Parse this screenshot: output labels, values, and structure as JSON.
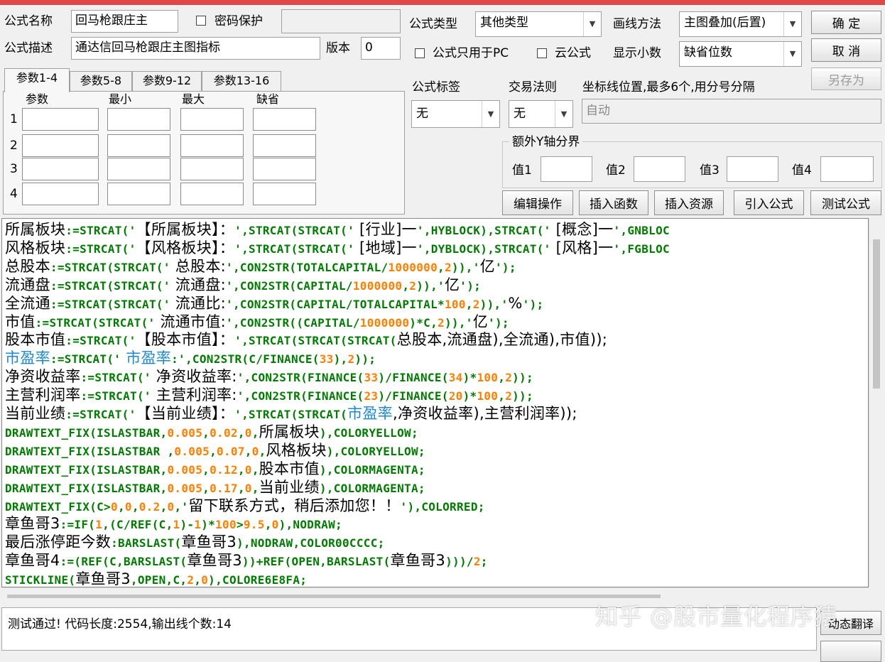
{
  "form": {
    "formula_name_label": "公式名称",
    "formula_name_value": "回马枪跟庄主",
    "password_protect_label": "密码保护",
    "password_value": "",
    "formula_desc_label": "公式描述",
    "formula_desc_value": "通达信回马枪跟庄主图指标",
    "version_label": "版本",
    "version_value": "0",
    "formula_type_label": "公式类型",
    "formula_type_value": "其他类型",
    "draw_method_label": "画线方法",
    "draw_method_value": "主图叠加(后置)",
    "pc_only_label": "公式只用于PC",
    "cloud_label": "云公式",
    "decimals_label": "显示小数",
    "decimals_value": "缺省位数",
    "tag_label": "公式标签",
    "tag_value": "无",
    "trade_rule_label": "交易法则",
    "trade_rule_value": "无",
    "axis_label": "坐标线位置,最多6个,用分号分隔",
    "axis_value": "自动",
    "extra_y_label": "额外Y轴分界",
    "y_values": [
      "值1",
      "值2",
      "值3",
      "值4"
    ]
  },
  "buttons": {
    "ok": "确  定",
    "cancel": "取  消",
    "save_as": "另存为",
    "edit": "编辑操作",
    "insert_func": "插入函数",
    "insert_res": "插入资源",
    "import": "引入公式",
    "test": "测试公式",
    "compile": "动态翻译"
  },
  "params": {
    "tabs": [
      "参数1-4",
      "参数5-8",
      "参数9-12",
      "参数13-16"
    ],
    "headers": [
      "参数",
      "最小",
      "最大",
      "缺省"
    ],
    "rows": [
      "1",
      "2",
      "3",
      "4"
    ]
  },
  "code_lines": [
    [
      [
        "v",
        "所属板块"
      ],
      [
        "f",
        ":=STRCAT('"
      ],
      [
        "b",
        "【所属板块】："
      ],
      [
        "f",
        "',STRCAT(STRCAT('"
      ],
      [
        "b",
        " [行业]一"
      ],
      [
        "f",
        "',HYBLOCK),STRCAT('"
      ],
      [
        "b",
        " [概念]一"
      ],
      [
        "f",
        "',GNBLOC"
      ]
    ],
    [
      [
        "v",
        "风格板块"
      ],
      [
        "f",
        ":=STRCAT('"
      ],
      [
        "b",
        "【风格板块】："
      ],
      [
        "f",
        "',STRCAT(STRCAT('"
      ],
      [
        "b",
        " [地域]一"
      ],
      [
        "f",
        "',DYBLOCK),STRCAT('"
      ],
      [
        "b",
        " [风格]一"
      ],
      [
        "f",
        "',FGBLOC"
      ]
    ],
    [
      [
        "v",
        "总股本"
      ],
      [
        "f",
        ":=STRCAT(STRCAT('"
      ],
      [
        "b",
        " 总股本:"
      ],
      [
        "f",
        "',CON2STR(TOTALCAPITAL/"
      ],
      [
        "n",
        "1000000"
      ],
      [
        "f",
        ","
      ],
      [
        "n",
        "2"
      ],
      [
        "f",
        "))"
      ],
      [
        "f",
        ",'"
      ],
      [
        "b",
        "亿"
      ],
      [
        "f",
        "');"
      ]
    ],
    [
      [
        "v",
        "流通盘"
      ],
      [
        "f",
        ":=STRCAT(STRCAT('"
      ],
      [
        "b",
        " 流通盘:"
      ],
      [
        "f",
        "',CON2STR(CAPITAL/"
      ],
      [
        "n",
        "1000000"
      ],
      [
        "f",
        ","
      ],
      [
        "n",
        "2"
      ],
      [
        "f",
        "))"
      ],
      [
        "f",
        ",'"
      ],
      [
        "b",
        "亿"
      ],
      [
        "f",
        "');"
      ]
    ],
    [
      [
        "v",
        "全流通"
      ],
      [
        "f",
        ":=STRCAT(STRCAT('"
      ],
      [
        "b",
        " 流通比:"
      ],
      [
        "f",
        "',CON2STR(CAPITAL/TOTALCAPITAL*"
      ],
      [
        "n",
        "100"
      ],
      [
        "f",
        ","
      ],
      [
        "n",
        "2"
      ],
      [
        "f",
        ")),'"
      ],
      [
        "b",
        "%"
      ],
      [
        "f",
        "');"
      ]
    ],
    [
      [
        "v",
        "市值"
      ],
      [
        "f",
        ":=STRCAT(STRCAT('"
      ],
      [
        "b",
        " 流通市值:"
      ],
      [
        "f",
        "',CON2STR((CAPITAL/"
      ],
      [
        "n",
        "1000000"
      ],
      [
        "f",
        ")*C,"
      ],
      [
        "n",
        "2"
      ],
      [
        "f",
        ")),'"
      ],
      [
        "b",
        "亿"
      ],
      [
        "f",
        "');"
      ]
    ],
    [
      [
        "v",
        "股本市值"
      ],
      [
        "f",
        ":=STRCAT('"
      ],
      [
        "b",
        "【股本市值】："
      ],
      [
        "f",
        "',STRCAT(STRCAT(STRCAT("
      ],
      [
        "b",
        "总股本,流通盘),全流通),市值));"
      ]
    ],
    [
      [
        "u",
        "市盈率"
      ],
      [
        "f",
        ":=STRCAT('"
      ],
      [
        "u",
        " 市盈率"
      ],
      [
        "f",
        ":',CON2STR(C/FINANCE("
      ],
      [
        "n",
        "33"
      ],
      [
        "f",
        "),"
      ],
      [
        "n",
        "2"
      ],
      [
        "f",
        "));"
      ]
    ],
    [
      [
        "v",
        "净资收益率"
      ],
      [
        "f",
        ":=STRCAT('"
      ],
      [
        "b",
        " 净资收益率:"
      ],
      [
        "f",
        "',CON2STR(FINANCE("
      ],
      [
        "n",
        "33"
      ],
      [
        "f",
        ")/FINANCE("
      ],
      [
        "n",
        "34"
      ],
      [
        "f",
        ")*"
      ],
      [
        "n",
        "100"
      ],
      [
        "f",
        ","
      ],
      [
        "n",
        "2"
      ],
      [
        "f",
        "));"
      ]
    ],
    [
      [
        "v",
        "主营利润率"
      ],
      [
        "f",
        ":=STRCAT('"
      ],
      [
        "b",
        " 主营利润率:"
      ],
      [
        "f",
        "',CON2STR(FINANCE("
      ],
      [
        "n",
        "23"
      ],
      [
        "f",
        ")/FINANCE("
      ],
      [
        "n",
        "20"
      ],
      [
        "f",
        ")*"
      ],
      [
        "n",
        "100"
      ],
      [
        "f",
        ","
      ],
      [
        "n",
        "2"
      ],
      [
        "f",
        "));"
      ]
    ],
    [
      [
        "v",
        "当前业绩"
      ],
      [
        "f",
        ":=STRCAT('"
      ],
      [
        "b",
        "【当前业绩】："
      ],
      [
        "f",
        "',STRCAT(STRCAT("
      ],
      [
        "u",
        "市盈率"
      ],
      [
        "b",
        ",净资收益率),主营利润率));"
      ]
    ],
    [
      [
        "f",
        "DRAWTEXT_FIX(ISLASTBAR,"
      ],
      [
        "n",
        "0.005"
      ],
      [
        "f",
        ","
      ],
      [
        "n",
        "0.02"
      ],
      [
        "f",
        ","
      ],
      [
        "n",
        "0"
      ],
      [
        "f",
        ","
      ],
      [
        "b",
        "所属板块"
      ],
      [
        "f",
        "),COLORYELLOW;"
      ]
    ],
    [
      [
        "f",
        "DRAWTEXT_FIX(ISLASTBAR ,"
      ],
      [
        "n",
        "0.005"
      ],
      [
        "f",
        ","
      ],
      [
        "n",
        "0.07"
      ],
      [
        "f",
        ","
      ],
      [
        "n",
        "0"
      ],
      [
        "f",
        ","
      ],
      [
        "b",
        "风格板块"
      ],
      [
        "f",
        "),COLORYELLOW;"
      ]
    ],
    [
      [
        "f",
        "DRAWTEXT_FIX(ISLASTBAR,"
      ],
      [
        "n",
        "0.005"
      ],
      [
        "f",
        ","
      ],
      [
        "n",
        "0.12"
      ],
      [
        "f",
        ","
      ],
      [
        "n",
        "0"
      ],
      [
        "f",
        ","
      ],
      [
        "b",
        "股本市值"
      ],
      [
        "f",
        "),COLORMAGENTA;"
      ]
    ],
    [
      [
        "f",
        "DRAWTEXT_FIX(ISLASTBAR,"
      ],
      [
        "n",
        "0.005"
      ],
      [
        "f",
        ","
      ],
      [
        "n",
        "0.17"
      ],
      [
        "f",
        ","
      ],
      [
        "n",
        "0"
      ],
      [
        "f",
        ","
      ],
      [
        "b",
        "当前业绩"
      ],
      [
        "f",
        "),COLORMAGENTA;"
      ]
    ],
    [
      [
        "f",
        "DRAWTEXT_FIX(C>"
      ],
      [
        "n",
        "0"
      ],
      [
        "f",
        ","
      ],
      [
        "n",
        "0"
      ],
      [
        "f",
        ","
      ],
      [
        "n",
        "0.2"
      ],
      [
        "f",
        ","
      ],
      [
        "n",
        "0"
      ],
      [
        "f",
        ",'"
      ],
      [
        "b",
        "留下联系方式，稍后添加您！！"
      ],
      [
        "f",
        "'),COLORRED;"
      ]
    ],
    [
      [
        "v",
        "章鱼哥3"
      ],
      [
        "f",
        ":=IF("
      ],
      [
        "n",
        "1"
      ],
      [
        "f",
        ",(C/REF(C,"
      ],
      [
        "n",
        "1"
      ],
      [
        "f",
        ")-"
      ],
      [
        "n",
        "1"
      ],
      [
        "f",
        ")*"
      ],
      [
        "n",
        "100"
      ],
      [
        "f",
        ">"
      ],
      [
        "n",
        "9.5"
      ],
      [
        "f",
        ","
      ],
      [
        "n",
        "0"
      ],
      [
        "f",
        "),NODRAW;"
      ]
    ],
    [
      [
        "v",
        "最后涨停距今数"
      ],
      [
        "f",
        ":BARSLAST("
      ],
      [
        "b",
        "章鱼哥3"
      ],
      [
        "f",
        "),NODRAW,COLOR00CCCC;"
      ]
    ],
    [
      [
        "v",
        "章鱼哥4"
      ],
      [
        "f",
        ":=(REF(C,BARSLAST("
      ],
      [
        "b",
        "章鱼哥3"
      ],
      [
        "f",
        "))+REF(OPEN,BARSLAST("
      ],
      [
        "b",
        "章鱼哥3"
      ],
      [
        "f",
        ")))/"
      ],
      [
        "n",
        "2"
      ],
      [
        "f",
        ";"
      ]
    ],
    [
      [
        "f",
        "STICKLINE("
      ],
      [
        "b",
        "章鱼哥3"
      ],
      [
        "f",
        ",OPEN,C,"
      ],
      [
        "n",
        "2"
      ],
      [
        "f",
        ","
      ],
      [
        "n",
        "0"
      ],
      [
        "f",
        "),COLORE6E8FA;"
      ]
    ]
  ],
  "status_text": "测试通过! 代码长度:2554,输出线个数:14",
  "watermark": "知乎 @股市量化程序猿"
}
